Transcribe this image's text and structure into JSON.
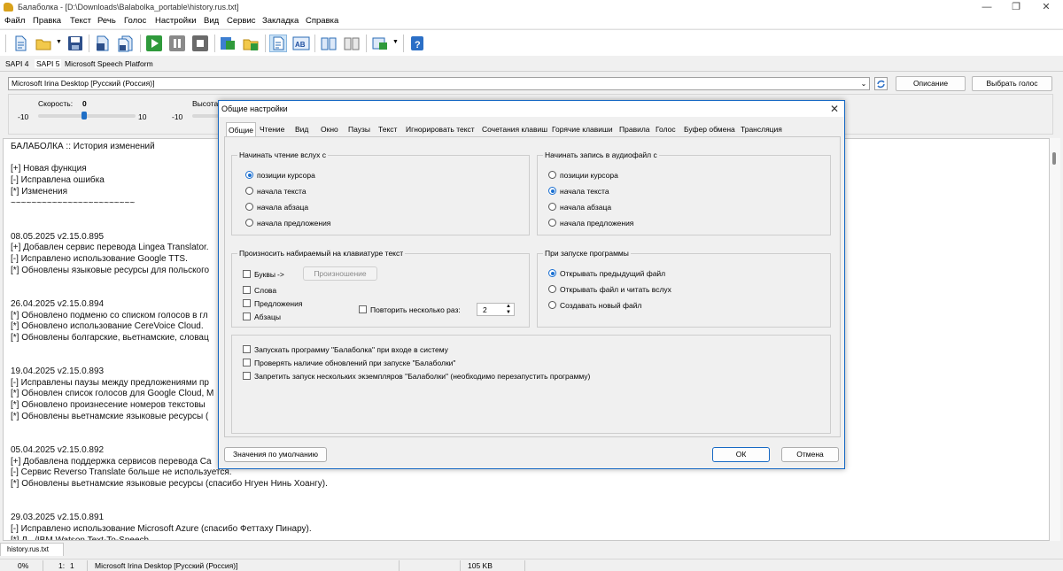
{
  "window": {
    "title": "Балаболка - [D:\\Downloads\\Balabolka_portable\\history.rus.txt]"
  },
  "menu": [
    "Файл",
    "Правка",
    "Текст",
    "Речь",
    "Голос",
    "Настройки",
    "Вид",
    "Сервис",
    "Закладка",
    "Справка"
  ],
  "sapi_tabs": [
    "SAPI 4",
    "SAPI 5",
    "Microsoft Speech Platform"
  ],
  "voice": {
    "selected": "Microsoft Irina Desktop [Русский (Россия)]",
    "description_button": "Описание",
    "choose_button": "Выбрать голос"
  },
  "sliders": {
    "speed_label": "Скорость:",
    "speed_value": "0",
    "speed_min": "-10",
    "speed_max": "10",
    "pitch_label": "Высота",
    "pitch_min": "-10"
  },
  "editor": {
    "lines": [
      "БАЛАБОЛКА :: История изменений",
      "",
      "[+] Новая функция",
      "[-] Исправлена ошибка",
      "[*] Изменения",
      "~~~~~~~~~~~~~~~~~~~~~~~~",
      "",
      "",
      "08.05.2025    v2.15.0.895",
      "[+] Добавлен сервис перевода Lingea Translator.",
      "[-] Исправлено использование Google TTS.",
      "[*] Обновлены языковые ресурсы для польского",
      "",
      "",
      "26.04.2025    v2.15.0.894",
      "[*] Обновлено подменю со списком голосов в гл",
      "[*] Обновлено использование CereVoice Cloud.",
      "[*] Обновлены болгарские, вьетнамские, словац",
      "",
      "",
      "19.04.2025    v2.15.0.893",
      "[-] Исправлены паузы между предложениями пр",
      "[*] Обновлен список голосов для Google Cloud, M",
      "[*] Обновлено произнесение номеров текстовы",
      "[*] Обновлены вьетнамские языковые ресурсы (",
      "",
      "",
      "05.04.2025    v2.15.0.892",
      "[+] Добавлена поддержка сервисов перевода Сa",
      "[-] Сервис Reverso Translate больше не используется.",
      "[*] Обновлены вьетнамские языковые ресурсы (спасибо Нгуен Нинь Хоангу).",
      "",
      "",
      "29.03.2025    v2.15.0.891",
      "[-] Исправлено использование Microsoft Azure (спасибо Феттаху Пинару).",
      "[*] Л.../IBM Watson Text-To-Speech..."
    ]
  },
  "doc_tab": "history.rus.txt",
  "status": {
    "percent": "0%",
    "line": "1:",
    "col": "1",
    "voice": "Microsoft Irina Desktop [Русский (Россия)]",
    "size": "105 KB"
  },
  "dialog": {
    "title": "Общие настройки",
    "tabs": [
      "Общие",
      "Чтение",
      "Вид",
      "Окно",
      "Паузы",
      "Текст",
      "Игнорировать текст",
      "Сочетания клавиш",
      "Горячие клавиши",
      "Правила",
      "Голос",
      "Буфер обмена",
      "Трансляция"
    ],
    "start_reading": {
      "title": "Начинать чтение вслух с",
      "options": [
        "позиции курсора",
        "начала текста",
        "начала абзаца",
        "начала предложения"
      ]
    },
    "start_recording": {
      "title": "Начинать запись в аудиофайл с",
      "options": [
        "позиции курсора",
        "начала текста",
        "начала абзаца",
        "начала предложения"
      ]
    },
    "typing": {
      "title": "Произносить набираемый на клавиатуре текст",
      "letters": "Буквы",
      "arrow": "->",
      "pronunciation_button": "Произношение",
      "words": "Слова",
      "sentences": "Предложения",
      "paragraphs": "Абзацы",
      "repeat_label": "Повторить несколько раз:",
      "repeat_value": "2"
    },
    "startup": {
      "title": "При запуске программы",
      "options": [
        "Открывать предыдущий файл",
        "Открывать файл и читать вслух",
        "Создавать новый файл"
      ]
    },
    "misc": [
      "Запускать программу \"Балаболка\" при входе в систему",
      "Проверять наличие обновлений при запуске \"Балаболки\"",
      "Запретить запуск нескольких экземпляров \"Балаболки\" (необходимо перезапустить программу)"
    ],
    "defaults_button": "Значения по умолчанию",
    "ok_button": "ОК",
    "cancel_button": "Отмена"
  }
}
